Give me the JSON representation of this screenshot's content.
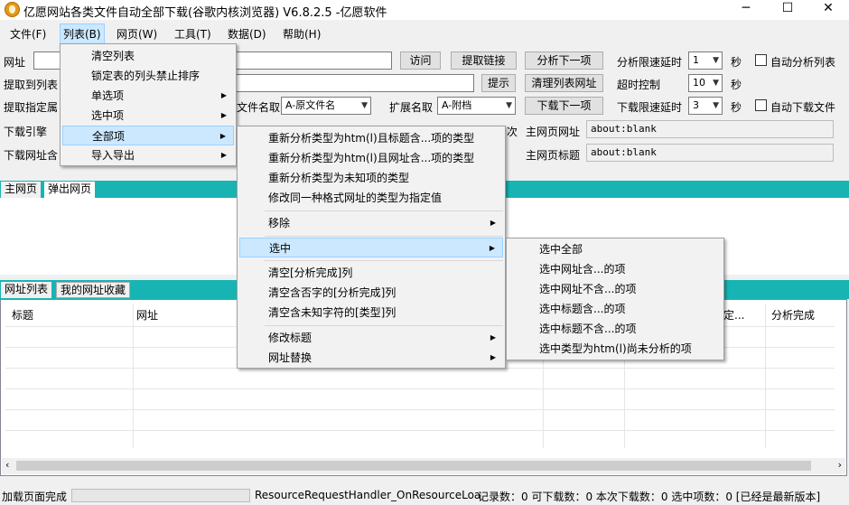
{
  "window": {
    "title": "亿愿网站各类文件自动全部下载(谷歌内核浏览器) V6.8.2.5 -亿愿软件",
    "minimize": "─",
    "maximize": "☐",
    "close": "✕"
  },
  "menubar": {
    "items": [
      "文件(F)",
      "列表(B)",
      "网页(W)",
      "工具(T)",
      "数据(D)",
      "帮助(H)"
    ]
  },
  "toolbar": {
    "url_label": "网址",
    "visit": "访问",
    "extract_links": "提取链接",
    "analyze_next": "分析下一项",
    "speed_limit_label": "分析限速延时",
    "speed_value": "1",
    "sec": "秒",
    "auto_analyze": "自动分析列表",
    "extract_to_list_label": "提取到列表",
    "tip": "提示",
    "clear_list_url": "清理列表网址",
    "timeout_label": "超时控制",
    "timeout_value": "10",
    "sec2": "秒",
    "extract_attr_label": "提取指定属",
    "filename_label": "文件名取",
    "filename_value": "A-原文件名",
    "ext_label": "扩展名取",
    "ext_value": "A-附档",
    "download_next": "下载下一项",
    "dl_limit_label": "下载限速延时",
    "dl_value": "3",
    "sec3": "秒",
    "auto_download": "自动下载文件",
    "engine_label": "下载引擎",
    "main_url_label": "主网页网址",
    "main_url_value": "about:blank",
    "dl_url_contains_label": "下载网址含",
    "main_title_label": "主网页标题",
    "main_title_value": "about:blank",
    "partial_next": "次"
  },
  "tabs_top": [
    "主网页",
    "弹出网页"
  ],
  "tabs_bottom": [
    "网址列表",
    "我的网址收藏"
  ],
  "table": {
    "columns": [
      "标题",
      "网址",
      "定...",
      "分析完成"
    ]
  },
  "statusbar": {
    "left": "加载页面完成",
    "message": "ResourceRequestHandler_OnResourceLoa",
    "stats": "记录数：0  可下载数：0  本次下载数：0  选中项数：0  [已经是最新版本]"
  },
  "menu1": {
    "items": [
      "清空列表",
      "锁定表的列头禁止排序",
      "单选项",
      "选中项",
      "全部项",
      "导入导出"
    ],
    "submenu_flags": [
      false,
      false,
      true,
      true,
      true,
      true
    ]
  },
  "menu2": {
    "items": [
      "重新分析类型为htm(l)且标题含...项的类型",
      "重新分析类型为htm(l)且网址含...项的类型",
      "重新分析类型为未知项的类型",
      "修改同一种格式网址的类型为指定值",
      "移除",
      "选中",
      "清空[分析完成]列",
      "清空含否字的[分析完成]列",
      "清空含未知字符的[类型]列",
      "修改标题",
      "网址替换"
    ]
  },
  "menu3": {
    "items": [
      "选中全部",
      "选中网址含...的项",
      "选中网址不含...的项",
      "选中标题含...的项",
      "选中标题不含...的项",
      "选中类型为htm(l)尚未分析的项"
    ]
  },
  "colors": {
    "teal_tabbar": "#18b4b4",
    "menu_highlight": "#cce8ff",
    "menu_highlight_border": "#99d1ff"
  }
}
